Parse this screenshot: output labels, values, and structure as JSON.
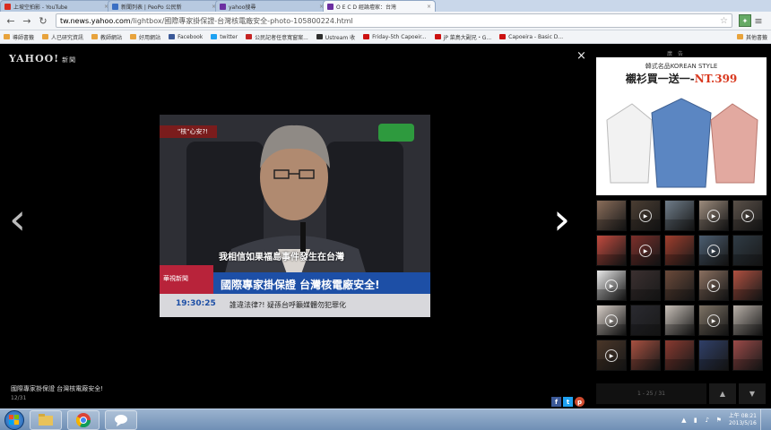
{
  "browser": {
    "tabs": [
      {
        "label": "上坡空拍影 - YouTube",
        "color": "#d92b1f"
      },
      {
        "label": "新聞列表 | PeoPo 公民新",
        "color": "#3b6fc3"
      },
      {
        "label": "yahoo搜尋",
        "color": "#6c2ea1"
      },
      {
        "label": "O E C D 經論壇家：台灣",
        "color": "#6c2ea1",
        "active": true
      }
    ],
    "url_host": "tw.news.yahoo.com",
    "url_path": "/lightbox/國際專家掛保證-台灣核電廠安全-photo-105800224.html",
    "bookmarks": [
      {
        "label": "導師書籤",
        "color": "#e8a33c"
      },
      {
        "label": "人已研究資訊",
        "color": "#e8a33c"
      },
      {
        "label": "教師網站",
        "color": "#e8a33c"
      },
      {
        "label": "好用網站",
        "color": "#e8a33c"
      },
      {
        "label": "Facebook",
        "color": "#3b5998"
      },
      {
        "label": "twitter",
        "color": "#1da1f2"
      },
      {
        "label": "公民記者任意寬窗案...",
        "color": "#c52323"
      },
      {
        "label": "Ustream 收",
        "color": "#2e2e2e"
      },
      {
        "label": "Friday-5th Capoeir...",
        "color": "#cc1111"
      },
      {
        "label": "jP 菜鳥大副兄・G...",
        "color": "#cc1111"
      },
      {
        "label": "Capoeira - Basic D...",
        "color": "#cc1111"
      }
    ],
    "bookmark_other": "其他書籤"
  },
  "viewer": {
    "logo": "YAHOO!",
    "logo_sub": "新聞",
    "caption": "國際專家掛保證 台灣核電廠安全!",
    "counter": "12/31",
    "close": "×",
    "prev": "‹",
    "next": "›"
  },
  "photo": {
    "tag": "\"核\"心安?!",
    "subtitle": "我相信如果福島事件發生在台灣",
    "show_label": "華視新聞",
    "headline": "國際專家掛保證 台灣核電廠安全!",
    "ticker_time": "19:30:25",
    "ticker_text": "誰違法律?! 疑孫台呼籲媒體勿犯罪化"
  },
  "sidebar": {
    "ad_label": "廣 告",
    "ad_brand": "韓式名品KOREAN STYLE",
    "ad_promo": "襯衫買一送一",
    "ad_price": "NT.399",
    "pager_info": "1 - 25 / 31",
    "pager_up": "▲",
    "pager_down": "▼",
    "thumbs": [
      {
        "color": "#8a6d5a",
        "play": false
      },
      {
        "color": "#4a3d32",
        "play": true
      },
      {
        "color": "#6f7d8a",
        "play": false
      },
      {
        "color": "#9c8b7c",
        "play": true
      },
      {
        "color": "#5a5048",
        "play": true
      },
      {
        "color": "#c24a3e",
        "play": false
      },
      {
        "color": "#7b2f2a",
        "play": true
      },
      {
        "color": "#a03e2d",
        "play": false
      },
      {
        "color": "#4b5d70",
        "play": true
      },
      {
        "color": "#2f3b45",
        "play": false
      },
      {
        "color": "#e9e9e9",
        "play": true
      },
      {
        "color": "#3b3030",
        "play": false
      },
      {
        "color": "#6b4a3a",
        "play": false
      },
      {
        "color": "#8a6f5f",
        "play": true
      },
      {
        "color": "#b05040",
        "play": false
      },
      {
        "color": "#d8cfc8",
        "play": true
      },
      {
        "color": "#2a2a30",
        "play": false
      },
      {
        "color": "#c8c0b8",
        "play": false
      },
      {
        "color": "#7d7264",
        "play": true
      },
      {
        "color": "#b8b0a8",
        "play": false
      },
      {
        "color": "#4a3628",
        "play": true
      },
      {
        "color": "#a85040",
        "play": false
      },
      {
        "color": "#8a3a30",
        "play": false
      },
      {
        "color": "#2f3f68",
        "play": false
      },
      {
        "color": "#9c4a48",
        "play": false
      }
    ]
  },
  "taskbar": {
    "clock_time": "上午 08:21",
    "clock_date": "2013/5/16"
  }
}
